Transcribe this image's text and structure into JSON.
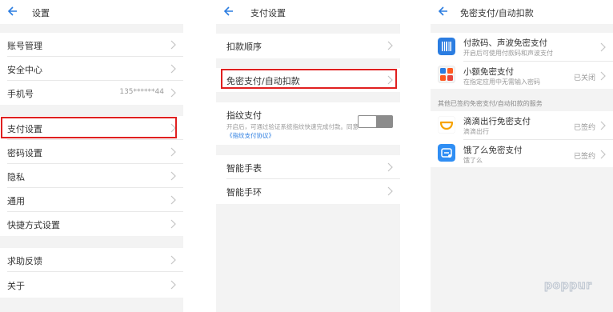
{
  "screen1": {
    "title": "设置",
    "items": [
      {
        "label": "账号管理"
      },
      {
        "label": "安全中心"
      },
      {
        "label": "手机号",
        "value": "135******44"
      },
      {
        "label": "支付设置"
      },
      {
        "label": "密码设置"
      },
      {
        "label": "隐私"
      },
      {
        "label": "通用"
      },
      {
        "label": "快捷方式设置"
      },
      {
        "label": "求助反馈"
      },
      {
        "label": "关于"
      }
    ]
  },
  "screen2": {
    "title": "支付设置",
    "items": [
      {
        "label": "扣款顺序"
      },
      {
        "label": "免密支付/自动扣款"
      },
      {
        "label": "指纹支付",
        "desc_prefix": "开启后，可通过验证系统指纹快速完成付款。同意",
        "desc_link": "《指纹支付协议》"
      },
      {
        "label": "智能手表"
      },
      {
        "label": "智能手环"
      }
    ],
    "fingerprint_enabled": false
  },
  "screen3": {
    "title": "免密支付/自动扣款",
    "items": [
      {
        "label": "付款码、声波免密支付",
        "sub": "开启后可使用付款码和声波支付",
        "icon": "barcode-icon"
      },
      {
        "label": "小额免密支付",
        "sub": "在指定应用中无需输入密码",
        "status": "已关闭",
        "icon": "taobao-alipay-icon"
      }
    ],
    "section_caption": "其他已签约免密支付/自动扣款的服务",
    "services": [
      {
        "label": "滴滴出行免密支付",
        "sub": "滴滴出行",
        "status": "已签约",
        "icon": "didi-icon",
        "color": "#f7a300"
      },
      {
        "label": "饿了么免密支付",
        "sub": "饿了么",
        "status": "已签约",
        "icon": "eleme-icon",
        "color": "#2f8ef4"
      }
    ]
  },
  "watermark": "poppur",
  "colors": {
    "highlight": "#e02020",
    "link": "#2b7de1",
    "back_arrow": "#2b7de1"
  }
}
